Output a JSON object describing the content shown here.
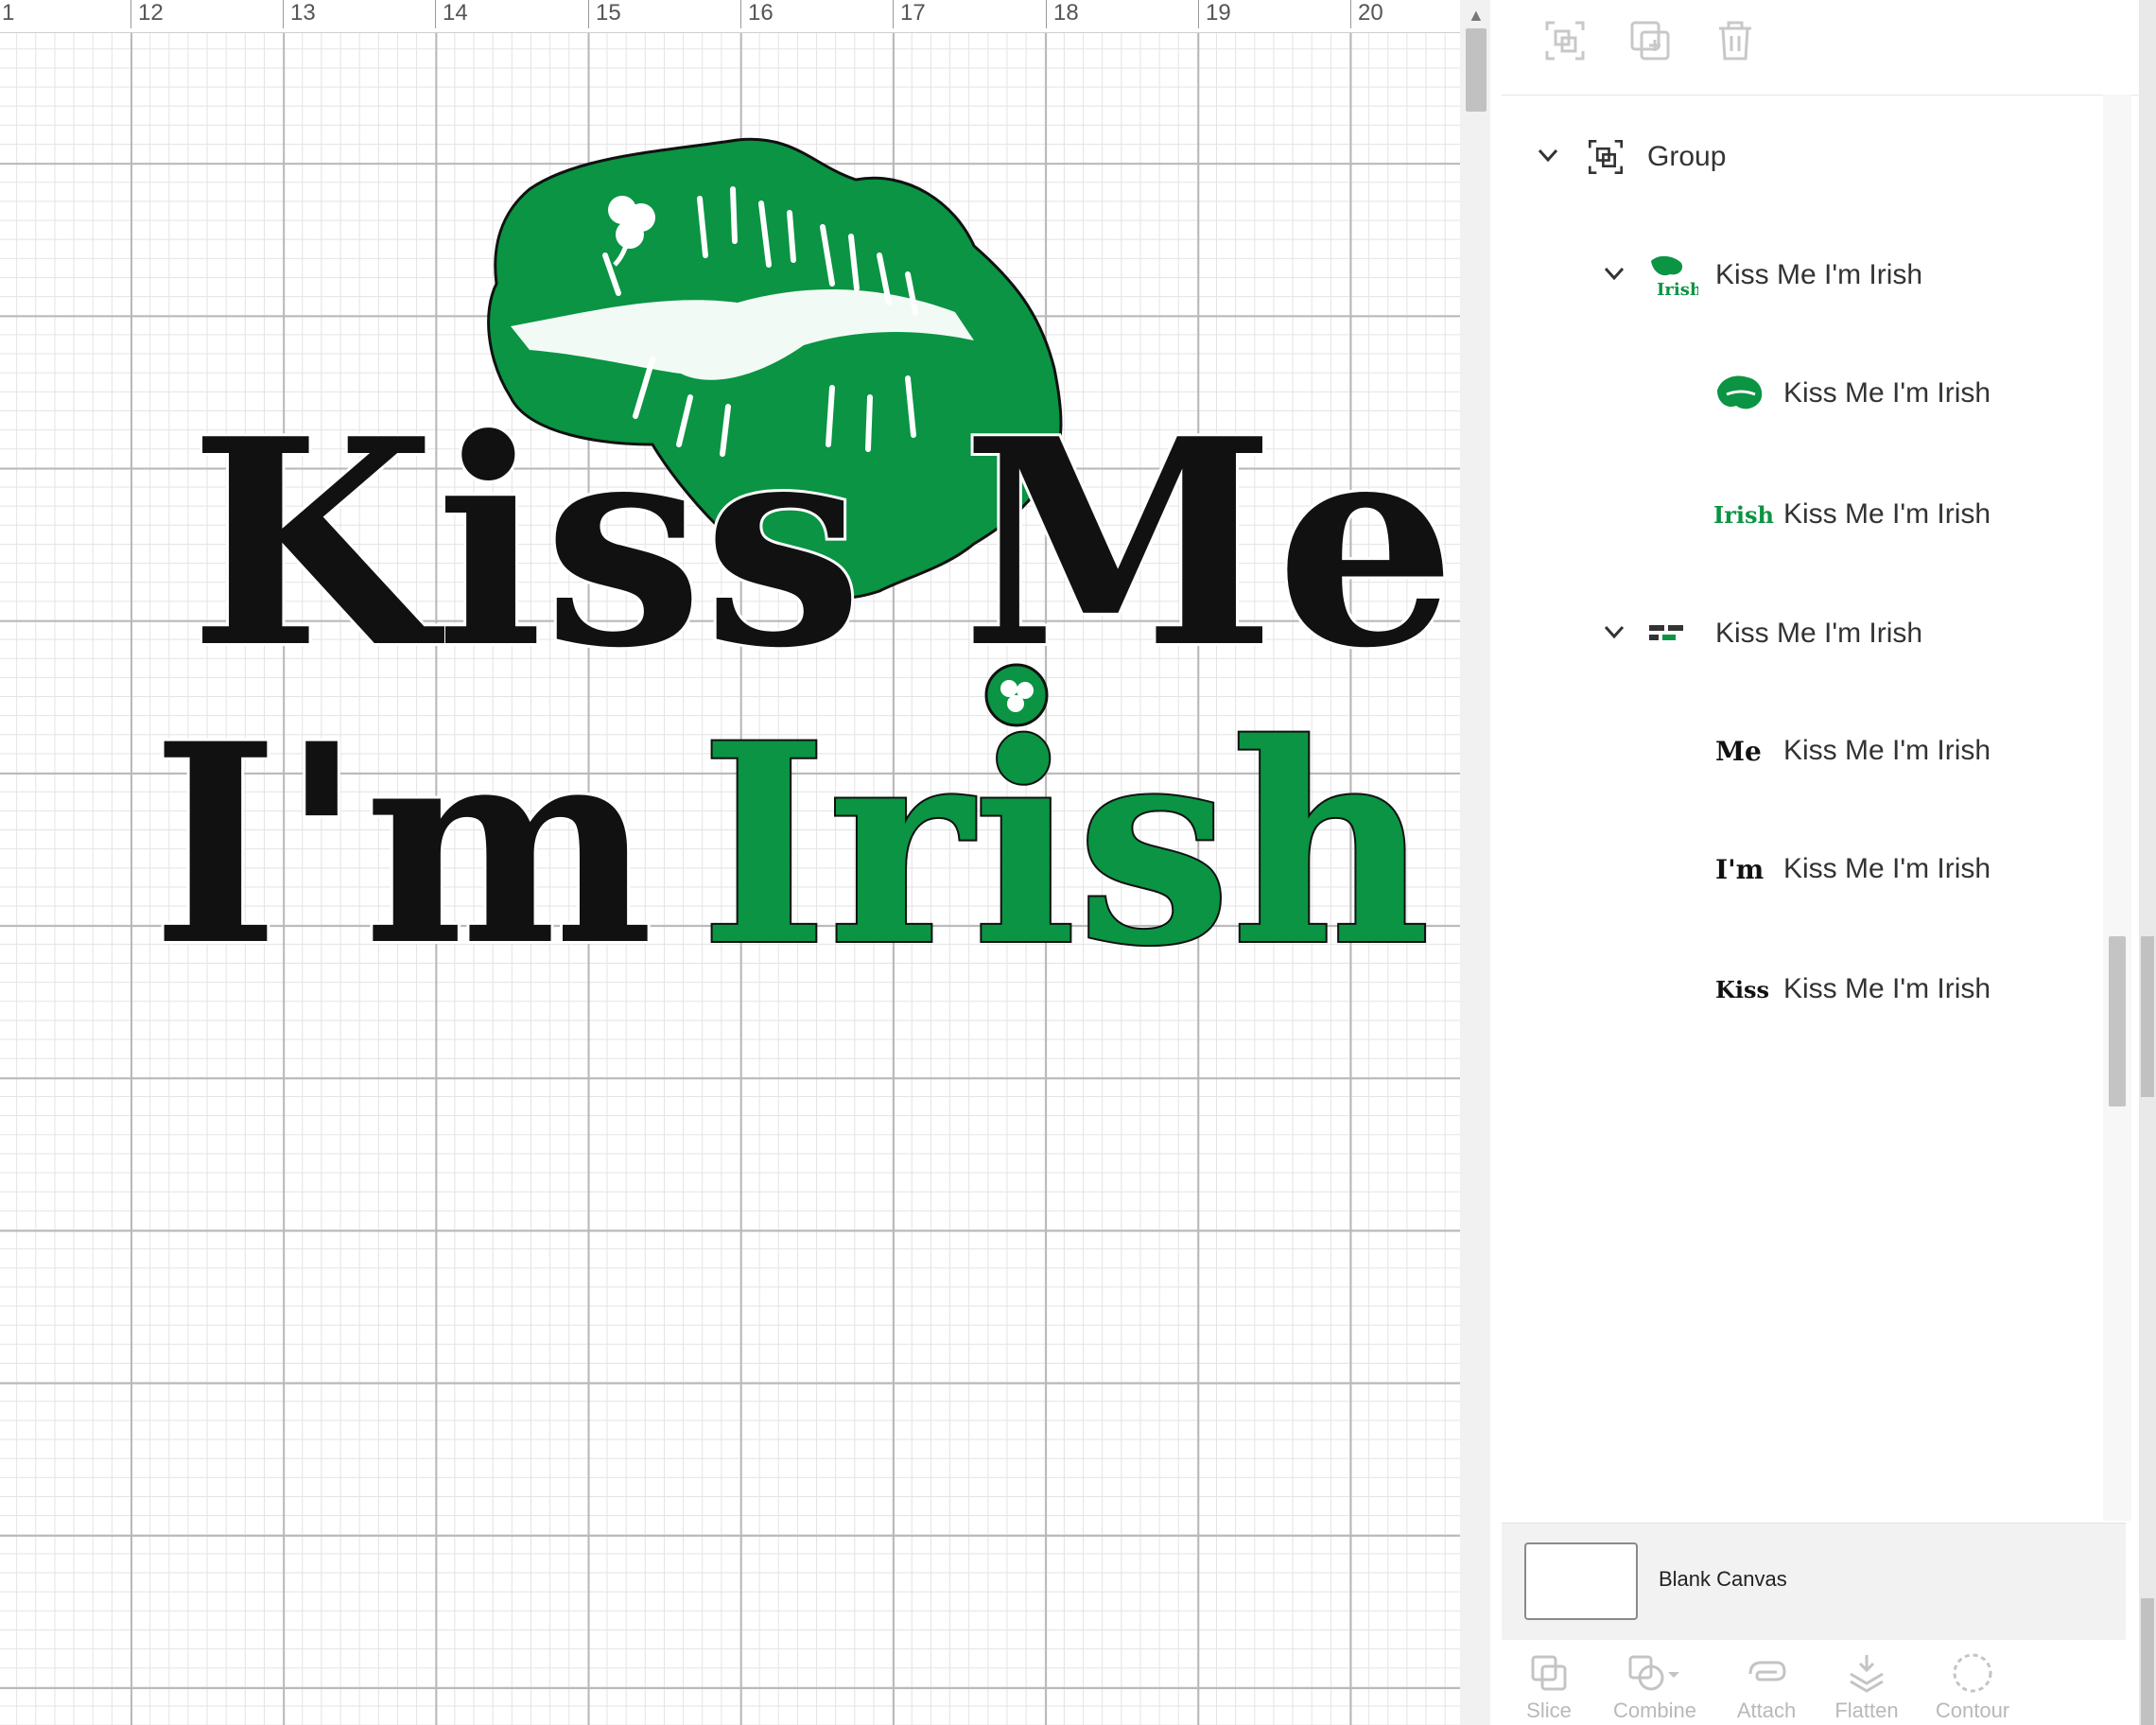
{
  "ruler": {
    "labels": [
      "1",
      "12",
      "13",
      "14",
      "15",
      "16",
      "17",
      "18",
      "19",
      "20"
    ]
  },
  "design": {
    "line1": "Kiss Me",
    "line2_black": "I'm",
    "line2_green": "Irish"
  },
  "colors": {
    "accent_green": "#0a9443",
    "ink": "#111111",
    "disabled": "#c8c8c8"
  },
  "panel": {
    "top_icons": [
      "group-icon",
      "duplicate-icon",
      "delete-icon"
    ],
    "layers": {
      "group_label": "Group",
      "sub1_label": "Kiss Me I'm Irish",
      "sub1_child1_label": "Kiss Me I'm Irish",
      "sub1_child2_label": "Kiss Me I'm Irish",
      "sub1_child2_thumb": "Irish",
      "sub2_label": "Kiss Me I'm Irish",
      "sub2_child1_label": "Kiss Me I'm Irish",
      "sub2_child1_thumb": "Me",
      "sub2_child2_label": "Kiss Me I'm Irish",
      "sub2_child2_thumb": "I'm",
      "sub2_child3_label": "Kiss Me I'm Irish",
      "sub2_child3_thumb": "Kiss"
    },
    "canvas_label": "Blank Canvas",
    "tools": {
      "slice": "Slice",
      "combine": "Combine",
      "attach": "Attach",
      "flatten": "Flatten",
      "contour": "Contour"
    }
  }
}
